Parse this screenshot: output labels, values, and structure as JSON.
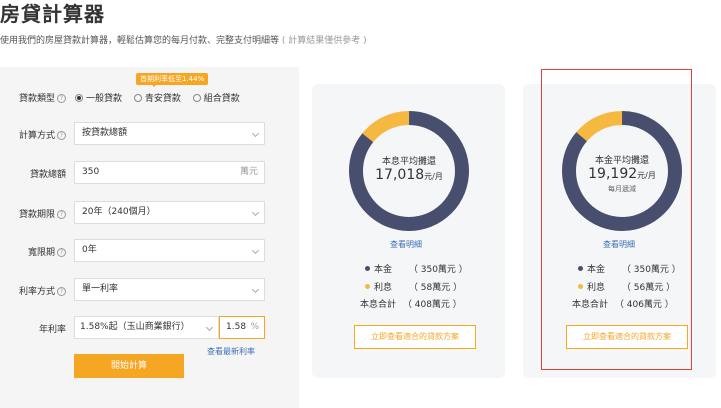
{
  "page": {
    "title": "房貸計算器",
    "subtitle": "使用我們的房屋貸款計算器，輕鬆估算您的每月付款、完整支付明細等",
    "subtitle_note": "( 計算結果僅供參考 )"
  },
  "form": {
    "promo_badge": "首期利率低至1.44%",
    "loan_type": {
      "label": "貸款類型",
      "options": [
        "一般貸款",
        "青安貸款",
        "組合貸款"
      ],
      "selected": "一般貸款"
    },
    "calc_method": {
      "label": "計算方式",
      "value": "按貸款總額"
    },
    "loan_amount": {
      "label": "貸款總額",
      "value": "350",
      "unit": "萬元"
    },
    "loan_term": {
      "label": "貸款期限",
      "value": "20年（240個月）"
    },
    "grace_period": {
      "label": "寬限期",
      "value": "0年"
    },
    "rate_type": {
      "label": "利率方式",
      "value": "單一利率"
    },
    "annual_rate": {
      "label": "年利率",
      "select_value": "1.58%起（玉山商業銀行）",
      "input_value": "1.58",
      "unit": "%"
    },
    "latest_rate_link": "查看最新利率",
    "calc_button": "開始計算"
  },
  "results": [
    {
      "center_label": "本息平均攤還",
      "amount": "17,018",
      "amount_unit": "元/月",
      "note": "",
      "detail_link": "查看明細",
      "principal_label": "本金",
      "principal_value": "（ 350萬元 ）",
      "interest_label": "利息",
      "interest_value": "（ 58萬元 ）",
      "total_label": "本息合計",
      "total_value": "（ 408萬元 ）",
      "cta": "立即查看適合的貸款方案",
      "principal_share": 0.858,
      "interest_share": 0.142
    },
    {
      "center_label": "本金平均攤還",
      "amount": "19,192",
      "amount_unit": "元/月",
      "note": "每月遞減",
      "detail_link": "查看明細",
      "principal_label": "本金",
      "principal_value": "（ 350萬元 ）",
      "interest_label": "利息",
      "interest_value": "（ 56萬元 ）",
      "total_label": "本息合計",
      "total_value": "（ 406萬元 ）",
      "cta": "立即查看適合的貸款方案",
      "principal_share": 0.862,
      "interest_share": 0.138
    }
  ],
  "colors": {
    "principal": "#474e6e",
    "interest": "#f5b942",
    "accent": "#f5a623",
    "link": "#3a6fb5",
    "highlight_border": "#e0403a"
  }
}
